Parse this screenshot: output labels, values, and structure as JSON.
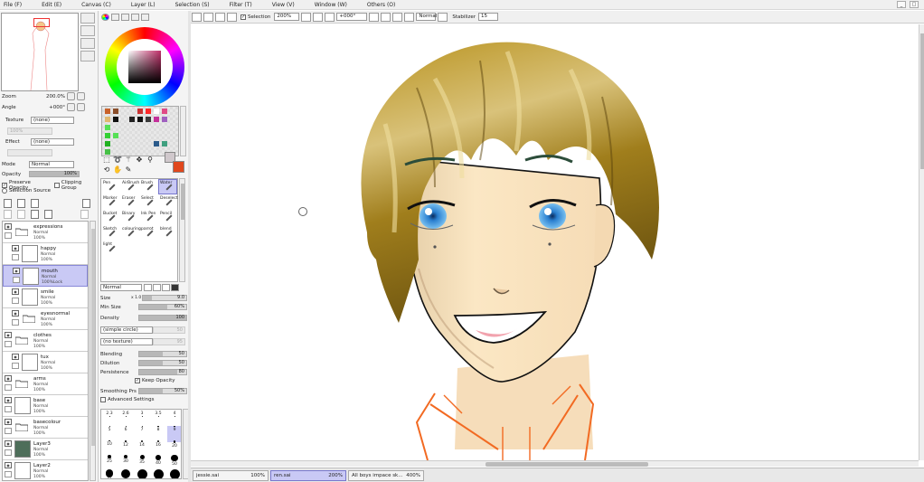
{
  "menu": [
    "File (F)",
    "Edit (E)",
    "Canvas (C)",
    "Layer (L)",
    "Selection (S)",
    "Filter (T)",
    "View (V)",
    "Window (W)",
    "Others (O)"
  ],
  "navigator": {
    "zoom_label": "Zoom",
    "zoom_value": "200.0%",
    "angle_label": "Angle",
    "angle_value": "+000°"
  },
  "layer_props": {
    "texture_label": "Texture",
    "texture_value": "(none)",
    "effect_label": "Effect",
    "effect_value": "(none)",
    "scale_label": "Scale",
    "scale_value": "100%",
    "mode_label": "Mode",
    "mode_value": "Normal",
    "opacity_label": "Opacity",
    "opacity_value": "100%",
    "preserve_opacity": "Preserve Opacity",
    "clipping_group": "Clipping Group",
    "selection_source": "Selection Source"
  },
  "layers": [
    {
      "name": "expressions",
      "mode": "Normal",
      "opacity": "100%",
      "type": "folder",
      "indent": 0
    },
    {
      "name": "happy",
      "mode": "Normal",
      "opacity": "100%",
      "type": "layer",
      "indent": 1
    },
    {
      "name": "mouth",
      "mode": "Normal",
      "opacity": "100%Lock",
      "type": "layer",
      "indent": 1,
      "selected": true
    },
    {
      "name": "smile",
      "mode": "Normal",
      "opacity": "100%",
      "type": "layer",
      "indent": 1
    },
    {
      "name": "eyesnormal",
      "mode": "Normal",
      "opacity": "100%",
      "type": "folder",
      "indent": 1
    },
    {
      "name": "clothes",
      "mode": "Normal",
      "opacity": "100%",
      "type": "folder",
      "indent": 0
    },
    {
      "name": "tux",
      "mode": "Normal",
      "opacity": "100%",
      "type": "layer",
      "indent": 1
    },
    {
      "name": "arms",
      "mode": "Normal",
      "opacity": "100%",
      "type": "folder",
      "indent": 0
    },
    {
      "name": "base",
      "mode": "Normal",
      "opacity": "100%",
      "type": "layer",
      "indent": 0
    },
    {
      "name": "basecolour",
      "mode": "Normal",
      "opacity": "100%",
      "type": "folder",
      "indent": 0
    },
    {
      "name": "Layer3",
      "mode": "Normal",
      "opacity": "100%",
      "type": "layer",
      "indent": 0,
      "thumb": "#4e6e5a"
    },
    {
      "name": "Layer2",
      "mode": "Normal",
      "opacity": "100%",
      "type": "layer",
      "indent": 0
    }
  ],
  "tools": [
    {
      "name": "Pen"
    },
    {
      "name": "AirBrush"
    },
    {
      "name": "Brush"
    },
    {
      "name": "Water",
      "active": true
    },
    {
      "name": "Marker"
    },
    {
      "name": "Eraser"
    },
    {
      "name": "Select"
    },
    {
      "name": "Deselect"
    },
    {
      "name": "Bucket"
    },
    {
      "name": "Binary"
    },
    {
      "name": "Ink Pen"
    },
    {
      "name": "Pencil"
    },
    {
      "name": "Sketch"
    },
    {
      "name": "colouring"
    },
    {
      "name": "parrot"
    },
    {
      "name": "blend"
    },
    {
      "name": "light"
    }
  ],
  "brush": {
    "mode": "Normal",
    "size_label": "Size",
    "size_mult": "x 1.0",
    "size_value": "9.0",
    "min_size_label": "Min Size",
    "min_size_value": "60%",
    "density_label": "Density",
    "density_value": "100",
    "shape": "(simple circle)",
    "shape_value": "50",
    "texture": "(no texture)",
    "texture_value": "95",
    "blending_label": "Blending",
    "blending_value": "50",
    "dilution_label": "Dilution",
    "dilution_value": "50",
    "persistence_label": "Persistence",
    "persistence_value": "80",
    "keep_opacity": "Keep Opacity",
    "smoothing_label": "Smoothing Prs",
    "smoothing_value": "50%",
    "advanced_settings": "Advanced Settings"
  },
  "brush_sizes": [
    "2.3",
    "2.6",
    "3",
    "3.5",
    "4",
    "5",
    "6",
    "7",
    "8",
    "9",
    "10",
    "12",
    "14",
    "16",
    "20",
    "25",
    "30",
    "35",
    "40",
    "50",
    "60",
    "70",
    "80",
    "100",
    "120"
  ],
  "toolbar": {
    "selection_label": "Selection",
    "zoom": "200%",
    "angle": "+000°",
    "blend_mode": "Normal",
    "stabilizer_label": "Stabilizer",
    "stabilizer_value": "15"
  },
  "tabs": [
    {
      "name": "jessie.sai",
      "zoom": "100%"
    },
    {
      "name": "ren.sai",
      "zoom": "200%",
      "active": true
    },
    {
      "name": "All boys impace sk...",
      "zoom": "400%"
    }
  ],
  "colors": {
    "accent": "#c9c9f5",
    "foreground": "#d0c8cc",
    "background": "#e0471c"
  }
}
